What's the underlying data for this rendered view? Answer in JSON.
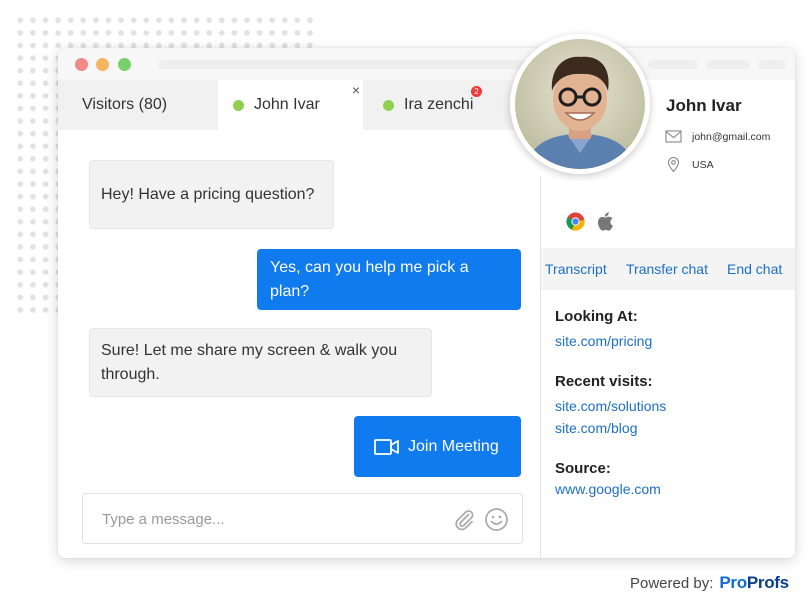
{
  "tabs": {
    "visitors_label": "Visitors (80)",
    "active_tab_label": "John Ivar",
    "close_glyph": "×",
    "second_tab_label": "Ira zenchi",
    "second_tab_badge": "2"
  },
  "messages": [
    {
      "from": "visitor",
      "text": "Hey! Have a pricing question?"
    },
    {
      "from": "agent",
      "text": "Yes, can you help me pick a plan?"
    },
    {
      "from": "visitor",
      "text": "Sure! Let me share my screen & walk you through."
    },
    {
      "from": "agent",
      "text": "Join Meeting",
      "icon": "video-camera-icon"
    }
  ],
  "composer": {
    "placeholder": "Type a message...",
    "value": ""
  },
  "visitor": {
    "name": "John Ivar",
    "email": "john@gmail.com",
    "location": "USA",
    "browser_icons": [
      "chrome-icon",
      "apple-icon"
    ]
  },
  "actions": {
    "transcript": "Transcript",
    "transfer": "Transfer chat",
    "end": "End chat"
  },
  "details": {
    "looking_at_label": "Looking At:",
    "looking_at_link": "site.com/pricing",
    "recent_visits_label": "Recent visits:",
    "recent_visits": [
      "site.com/solutions",
      "site.com/blog"
    ],
    "source_label": "Source:",
    "source_link": "www.google.com"
  },
  "footer": {
    "powered_by": "Powered by:",
    "brand_part1": "Pro",
    "brand_part2": "Profs"
  },
  "colors": {
    "accent_blue": "#0f7bef",
    "link_blue": "#1c6fc7",
    "online_green": "#8fd14f",
    "badge_red": "#ef3b3b"
  }
}
